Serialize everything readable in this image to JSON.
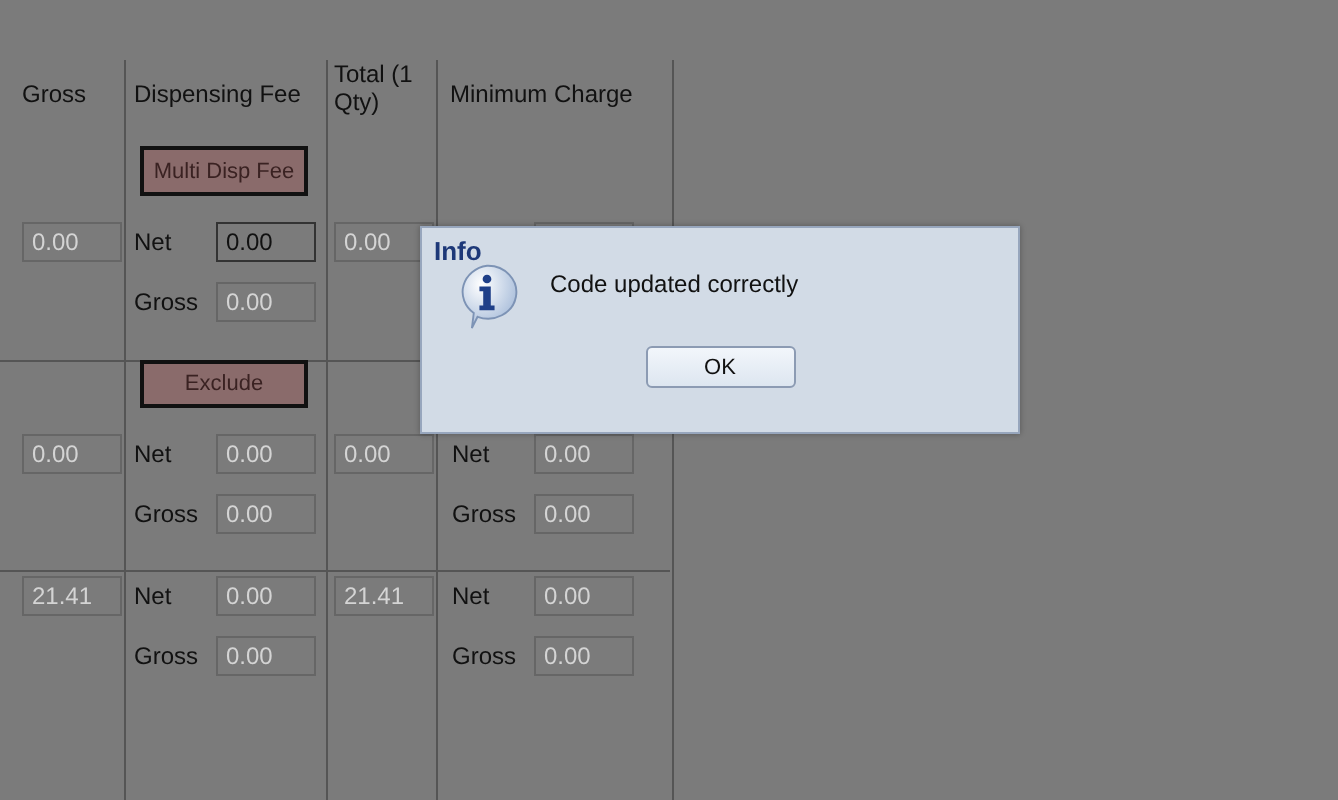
{
  "columns": [
    "Gross",
    "Dispensing Fee",
    "Total (1 Qty)",
    "Minimum Charge"
  ],
  "rows": [
    {
      "gross": "0.00",
      "fee_button": "Multi Disp Fee",
      "fee": [
        {
          "label": "Net",
          "value": "0.00",
          "disabled": false
        },
        {
          "label": "Gross",
          "value": "0.00",
          "disabled": true
        }
      ],
      "total": "0.00"
    },
    {
      "gross": "0.00",
      "fee_button": "Exclude",
      "fee": [
        {
          "label": "Net",
          "value": "0.00",
          "disabled": true
        },
        {
          "label": "Gross",
          "value": "0.00",
          "disabled": true
        }
      ],
      "total": "0.00",
      "minimum": [
        {
          "label": "Net",
          "value": "0.00",
          "disabled": true
        },
        {
          "label": "Gross",
          "value": "0.00",
          "disabled": true
        }
      ]
    },
    {
      "gross": "21.41",
      "fee": [
        {
          "label": "Net",
          "value": "0.00",
          "disabled": true
        },
        {
          "label": "Gross",
          "value": "0.00",
          "disabled": true
        }
      ],
      "total": "21.41",
      "minimum": [
        {
          "label": "Net",
          "value": "0.00",
          "disabled": true
        },
        {
          "label": "Gross",
          "value": "0.00",
          "disabled": true
        }
      ]
    }
  ],
  "dialog": {
    "title": "Info",
    "message": "Code updated correctly",
    "button": "OK"
  }
}
